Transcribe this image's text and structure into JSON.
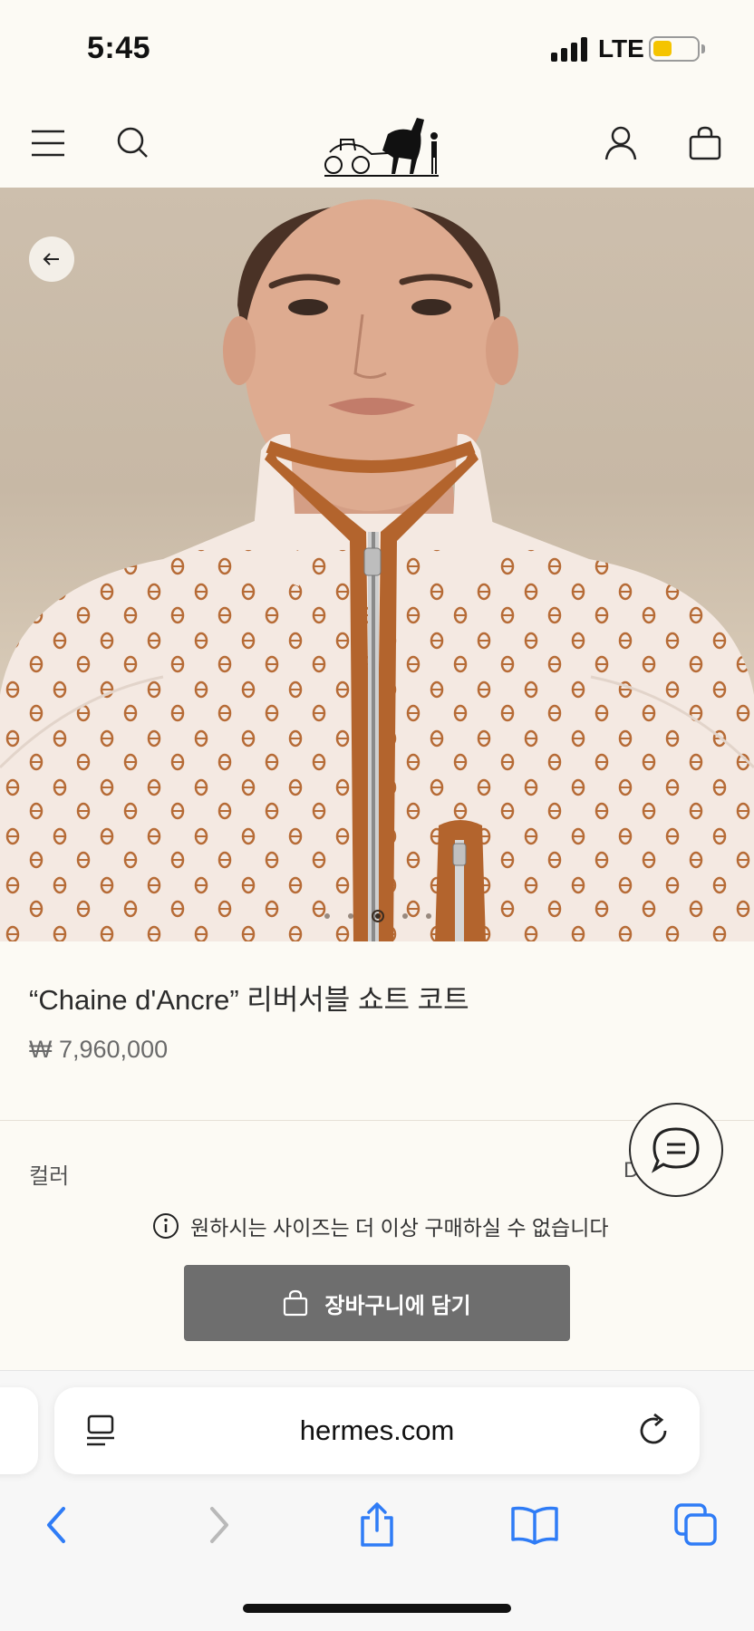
{
  "status_bar": {
    "time": "5:45",
    "network": "LTE"
  },
  "header": {
    "menu_icon": "hamburger-menu-icon",
    "search_icon": "search-icon",
    "logo": "hermes-carriage-logo",
    "account_icon": "user-icon",
    "bag_icon": "shopping-bag-icon"
  },
  "gallery": {
    "total_images": 5,
    "active_index": 2
  },
  "product": {
    "name": "“Chaine d'Ancre” 리버서블 쇼트 코트",
    "price": "₩ 7,960,000",
    "color_label": "컬러",
    "color_value": "D"
  },
  "notice": {
    "text": "원하시는 사이즈는 더 이상 구매하실 수 없습니다"
  },
  "cart_button": {
    "label": "장바구니에 담기"
  },
  "browser": {
    "url": "hermes.com"
  },
  "colors": {
    "page_bg": "#fcfaf4",
    "cart_button_bg": "#6e6e6e",
    "ios_blue": "#2f7cf6",
    "jacket_accent": "#b3642d"
  }
}
